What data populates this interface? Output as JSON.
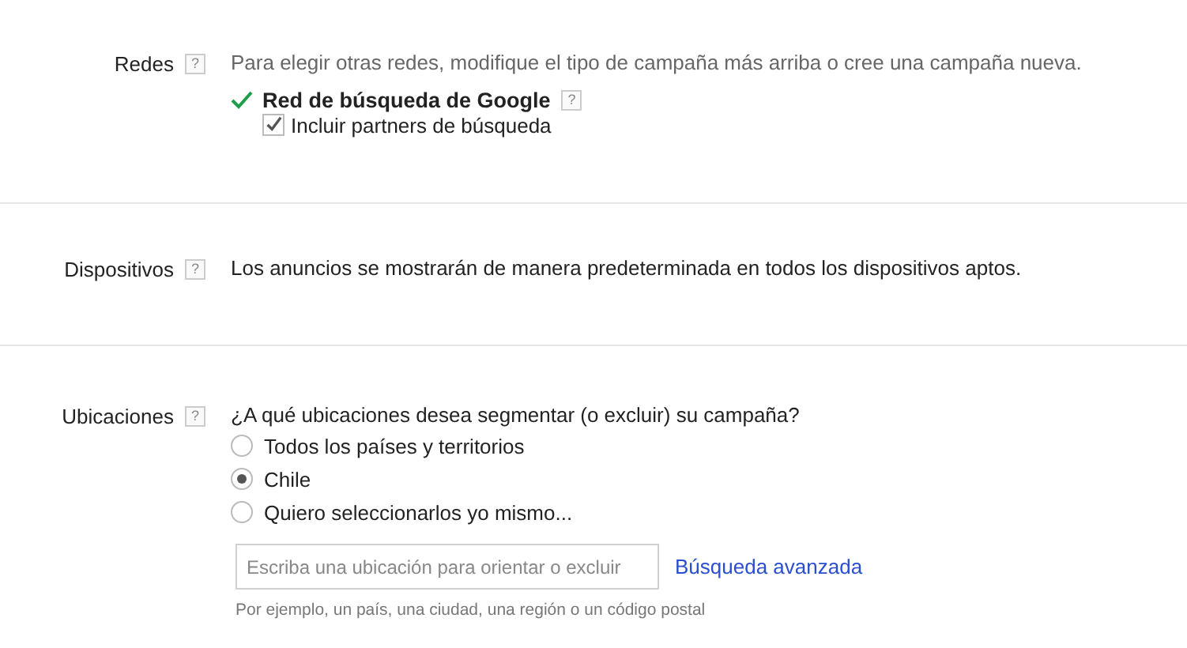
{
  "sections": [
    {
      "kind": "networks",
      "label": "Redes",
      "help": "?",
      "description": "Para elegir otras redes, modifique el tipo de campaña más arriba o cree una campaña nueva.",
      "network": {
        "name": "Red de búsqueda de Google",
        "help": "?",
        "enabled": true
      },
      "option": {
        "label": "Incluir partners de búsqueda",
        "checked": true
      }
    },
    {
      "kind": "devices",
      "label": "Dispositivos",
      "help": "?",
      "description": "Los anuncios se mostrarán de manera predeterminada en todos los dispositivos aptos."
    },
    {
      "kind": "locations",
      "label": "Ubicaciones",
      "help": "?",
      "question": "¿A qué ubicaciones desea segmentar (o excluir) su campaña?",
      "options": [
        {
          "label": "Todos los países y territorios",
          "selected": false
        },
        {
          "label": "Chile",
          "selected": true
        },
        {
          "label": "Quiero seleccionarlos yo mismo...",
          "selected": false
        }
      ],
      "search": {
        "placeholder": "Escriba una ubicación para orientar o excluir"
      },
      "link": "Búsqueda avanzada",
      "hint": "Por ejemplo, un país, una ciudad, una región o un código postal"
    }
  ]
}
